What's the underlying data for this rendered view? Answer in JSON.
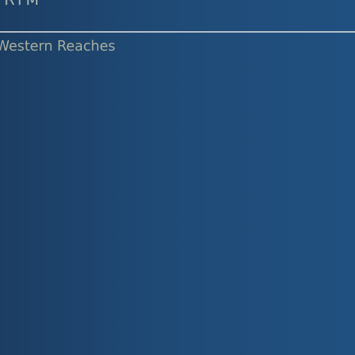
{
  "header": {
    "title": "RTM"
  },
  "subtitle": {
    "region": "Western Reaches"
  }
}
